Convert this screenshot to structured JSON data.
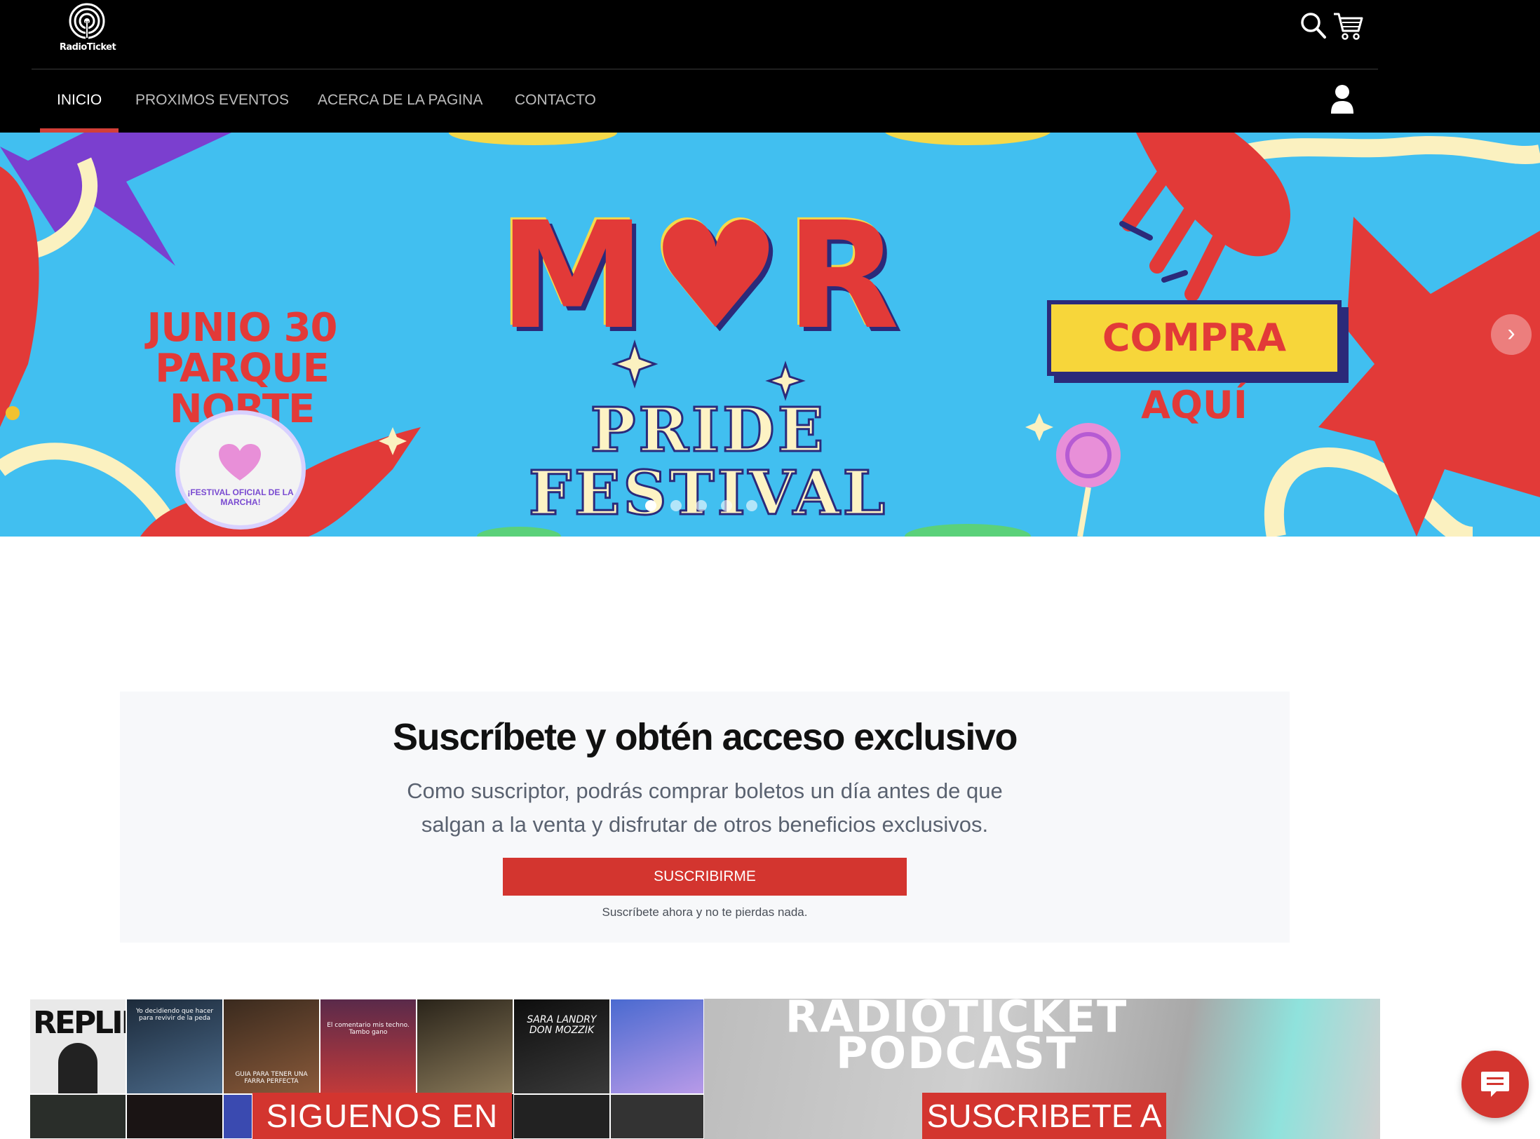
{
  "brand": {
    "name": "RadioTicket",
    "accent": "#d3352f"
  },
  "header": {
    "icons": [
      "search-icon",
      "cart-icon",
      "user-icon"
    ]
  },
  "nav": {
    "items": [
      {
        "label": "INICIO",
        "active": true
      },
      {
        "label": "PROXIMOS EVENTOS",
        "active": false
      },
      {
        "label": "ACERCA DE LA PAGINA",
        "active": false
      },
      {
        "label": "CONTACTO",
        "active": false
      }
    ]
  },
  "banner": {
    "date_line1": "JUNIO 30",
    "date_line2": "PARQUE NORTE",
    "title": "M♥R",
    "subtitle": "PRIDE FESTIVAL",
    "cta": "COMPRA AQUÍ",
    "badge": "¡FESTIVAL OFICIAL DE LA MARCHA!",
    "slide_count": 5,
    "active_slide": 1
  },
  "subscribe": {
    "title": "Suscríbete y obtén acceso exclusivo",
    "description": "Como suscriptor, podrás comprar boletos un día antes de que salgan a la venta y disfrutar de otros beneficios exclusivos.",
    "button": "SUSCRIBIRME",
    "note": "Suscríbete ahora y no te pierdas nada."
  },
  "instagram": {
    "label": "SIGUENOS EN",
    "captions": [
      "REPLIK",
      "Yo decidiendo que hacer para revivir de la peda",
      "GUIA PARA TENER UNA FARRA PERFECTA",
      "El comentario mis techno. Tambo gano",
      "",
      "SARA LANDRY DON MOZZIK",
      ""
    ]
  },
  "podcast": {
    "title_line1": "RADIOTICKET",
    "title_line2": "PODCAST",
    "label": "SUSCRIBETE A"
  }
}
